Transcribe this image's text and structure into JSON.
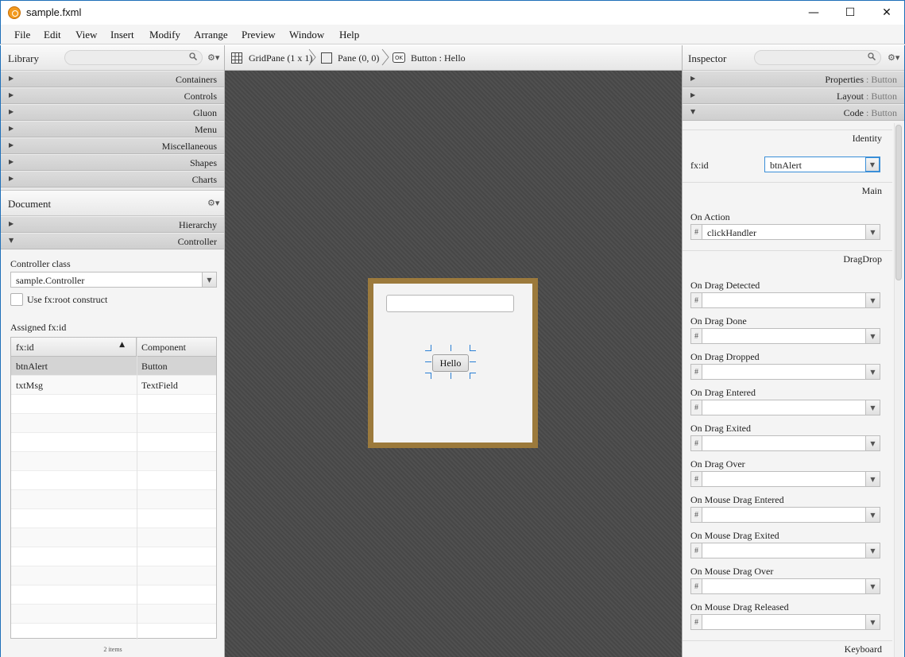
{
  "window": {
    "title": "sample.fxml",
    "minimize_glyph": "—",
    "maximize_glyph": "☐",
    "close_glyph": "✕"
  },
  "menubar": {
    "items": [
      "File",
      "Edit",
      "View",
      "Insert",
      "Modify",
      "Arrange",
      "Preview",
      "Window",
      "Help"
    ]
  },
  "library": {
    "title": "Library",
    "sections": [
      "Containers",
      "Controls",
      "Gluon",
      "Menu",
      "Miscellaneous",
      "Shapes",
      "Charts"
    ]
  },
  "document": {
    "title": "Document",
    "sections": [
      "Hierarchy",
      "Controller"
    ],
    "controller_class_label": "Controller class",
    "controller_class_value": "sample.Controller",
    "fxroot_label": "Use fx:root construct",
    "assigned_label": "Assigned fx:id",
    "table": {
      "columns": [
        "fx:id",
        "Component"
      ],
      "sort_glyph": "▲",
      "rows": [
        [
          "btnAlert",
          "Button"
        ],
        [
          "txtMsg",
          "TextField"
        ]
      ],
      "footer": "2 items"
    }
  },
  "breadcrumb": {
    "items": [
      "GridPane (1 x 1)",
      "Pane (0, 0)",
      "Button : Hello"
    ],
    "ok_icon_text": "OK"
  },
  "canvas": {
    "button_text": "Hello",
    "frame_color": "#9c7a3c"
  },
  "inspector": {
    "title": "Inspector",
    "sections": [
      {
        "label": "Properties",
        "target": "Button",
        "expanded": false
      },
      {
        "label": "Layout",
        "target": "Button",
        "expanded": false
      },
      {
        "label": "Code",
        "target": "Button",
        "expanded": true
      }
    ],
    "identity_label": "Identity",
    "fxid_label": "fx:id",
    "fxid_value": "btnAlert",
    "main_label": "Main",
    "on_action_label": "On Action",
    "on_action_value": "clickHandler",
    "dragdrop_label": "DragDrop",
    "drag_events": [
      "On Drag Detected",
      "On Drag Done",
      "On Drag Dropped",
      "On Drag Entered",
      "On Drag Exited",
      "On Drag Over",
      "On Mouse Drag Entered",
      "On Mouse Drag Exited",
      "On Mouse Drag Over",
      "On Mouse Drag Released"
    ],
    "keyboard_label": "Keyboard",
    "hash_glyph": "#"
  },
  "icons": {
    "gear": "⚙▾",
    "expand_closed": "▶",
    "expand_open": "▼",
    "dropdown": "▼"
  },
  "colors": {
    "accent_border": "#1e6fb8",
    "selection_handles": "#2a7fd4",
    "canvas_bg": "#4a4a4a"
  }
}
